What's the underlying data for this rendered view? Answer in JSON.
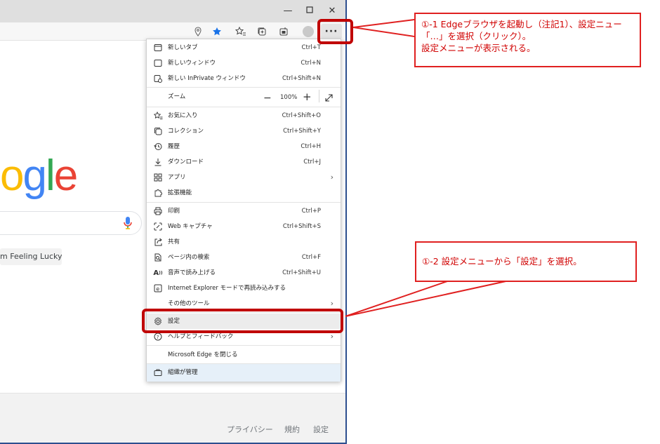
{
  "google": {
    "logo_letters": [
      {
        "ch": "o",
        "color": "#fbbc05"
      },
      {
        "ch": "g",
        "color": "#4285f4"
      },
      {
        "ch": "l",
        "color": "#34a853"
      },
      {
        "ch": "e",
        "color": "#ea4335"
      }
    ],
    "lucky_button": "m Feeling Lucky",
    "footer_links": [
      "プライバシー",
      "規約",
      "設定"
    ]
  },
  "toolbar": {
    "more_label": "···"
  },
  "menu": {
    "items": [
      {
        "id": "new-tab",
        "label": "新しいタブ",
        "shortcut": "Ctrl+T",
        "icon": "new-tab-icon"
      },
      {
        "id": "new-window",
        "label": "新しいウィンドウ",
        "shortcut": "Ctrl+N",
        "icon": "new-window-icon"
      },
      {
        "id": "inprivate",
        "label": "新しい InPrivate ウィンドウ",
        "shortcut": "Ctrl+Shift+N",
        "icon": "inprivate-icon"
      },
      {
        "id": "favorites",
        "label": "お気に入り",
        "shortcut": "Ctrl+Shift+O",
        "icon": "favorites-icon"
      },
      {
        "id": "collections",
        "label": "コレクション",
        "shortcut": "Ctrl+Shift+Y",
        "icon": "collections-icon"
      },
      {
        "id": "history",
        "label": "履歴",
        "shortcut": "Ctrl+H",
        "icon": "history-icon"
      },
      {
        "id": "downloads",
        "label": "ダウンロード",
        "shortcut": "Ctrl+J",
        "icon": "download-icon"
      },
      {
        "id": "apps",
        "label": "アプリ",
        "shortcut": "",
        "icon": "apps-icon"
      },
      {
        "id": "extensions",
        "label": "拡張機能",
        "shortcut": "",
        "icon": "puzzle-icon"
      },
      {
        "id": "print",
        "label": "印刷",
        "shortcut": "Ctrl+P",
        "icon": "print-icon"
      },
      {
        "id": "web-capture",
        "label": "Web キャプチャ",
        "shortcut": "Ctrl+Shift+S",
        "icon": "web-capture-icon"
      },
      {
        "id": "share",
        "label": "共有",
        "shortcut": "",
        "icon": "share-icon"
      },
      {
        "id": "find",
        "label": "ページ内の検索",
        "shortcut": "Ctrl+F",
        "icon": "find-icon"
      },
      {
        "id": "read-aloud",
        "label": "音声で読み上げる",
        "shortcut": "Ctrl+Shift+U",
        "icon": "read-aloud-icon"
      },
      {
        "id": "ie-mode",
        "label": "Internet Explorer モードで再読み込みする",
        "shortcut": "",
        "icon": "ie-icon"
      },
      {
        "id": "more-tools",
        "label": "その他のツール",
        "shortcut": "",
        "icon": ""
      },
      {
        "id": "settings",
        "label": "設定",
        "shortcut": "",
        "icon": "gear-icon"
      },
      {
        "id": "help",
        "label": "ヘルプとフィードバック",
        "shortcut": "",
        "icon": "help-icon"
      },
      {
        "id": "close-edge",
        "label": "Microsoft Edge を閉じる",
        "shortcut": "",
        "icon": ""
      },
      {
        "id": "org",
        "label": "組織が管理",
        "shortcut": "",
        "icon": "briefcase-icon"
      }
    ],
    "zoom": {
      "label": "ズーム",
      "minus": "−",
      "value": "100%",
      "plus": "+"
    }
  },
  "callouts": {
    "first": {
      "line1": "①-1 Edgeブラウザを起動し（注記1）、設定ニュー",
      "line2": "「…」を選択（クリック）。",
      "line3": "設定メニューが表示される。"
    },
    "second": {
      "line1": "①-2 設定メニューから「設定」を選択。"
    },
    "color": "#e02020"
  }
}
